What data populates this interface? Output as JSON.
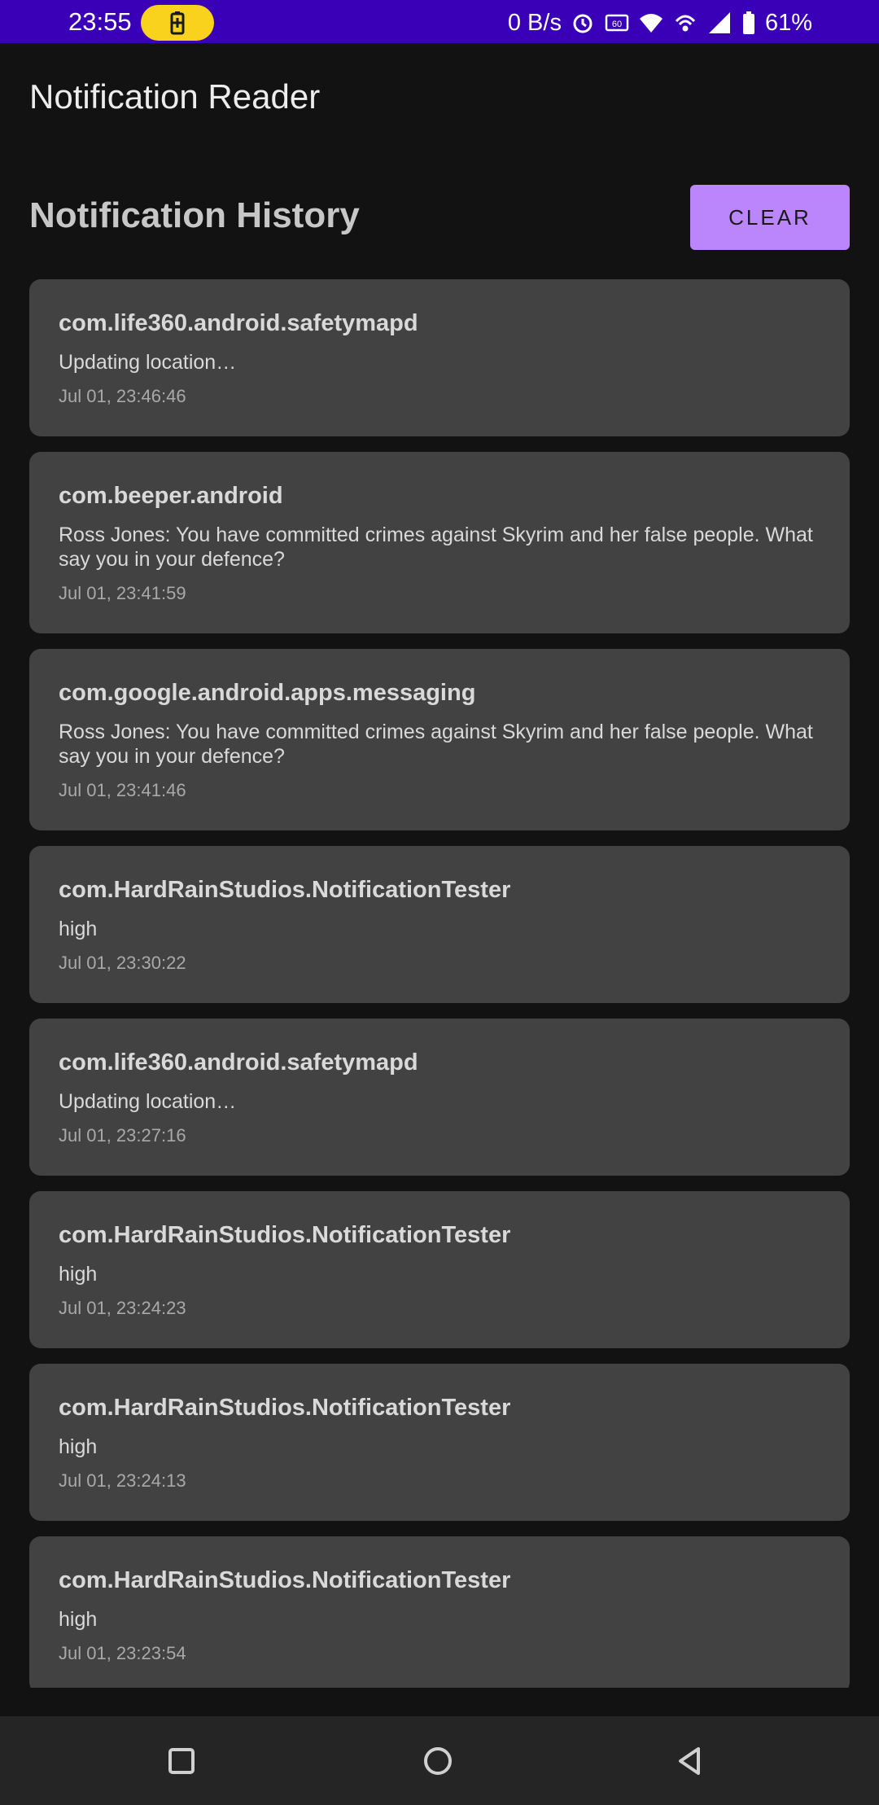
{
  "status_bar": {
    "time": "23:55",
    "net_speed": "0 B/s",
    "battery_percent": "61%",
    "bg_color": "#3a00b8",
    "pill_color": "#f8d21c",
    "icons": [
      "battery-saver-icon",
      "alarm-icon",
      "hd-icon",
      "wifi-icon",
      "hotspot-icon",
      "signal-icon",
      "battery-icon"
    ]
  },
  "app_bar": {
    "title": "Notification Reader"
  },
  "history": {
    "title": "Notification History",
    "clear_label": "CLEAR",
    "accent": "#bb86fc"
  },
  "notifications": [
    {
      "app": "com.life360.android.safetymapd",
      "text": "Updating location…",
      "time": "Jul 01, 23:46:46"
    },
    {
      "app": "com.beeper.android",
      "text": "Ross Jones: You have committed crimes against Skyrim and her false people. What say you in your defence?",
      "time": "Jul 01, 23:41:59"
    },
    {
      "app": "com.google.android.apps.messaging",
      "text": "Ross Jones: You have committed crimes against Skyrim and her false people. What say you in your defence?",
      "time": "Jul 01, 23:41:46"
    },
    {
      "app": "com.HardRainStudios.NotificationTester",
      "text": "high",
      "time": "Jul 01, 23:30:22"
    },
    {
      "app": "com.life360.android.safetymapd",
      "text": "Updating location…",
      "time": "Jul 01, 23:27:16"
    },
    {
      "app": "com.HardRainStudios.NotificationTester",
      "text": "high",
      "time": "Jul 01, 23:24:23"
    },
    {
      "app": "com.HardRainStudios.NotificationTester",
      "text": "high",
      "time": "Jul 01, 23:24:13"
    },
    {
      "app": "com.HardRainStudios.NotificationTester",
      "text": "high",
      "time": "Jul 01, 23:23:54"
    }
  ],
  "nav_bar": {
    "icons": [
      "recents-icon",
      "home-icon",
      "back-icon"
    ]
  }
}
